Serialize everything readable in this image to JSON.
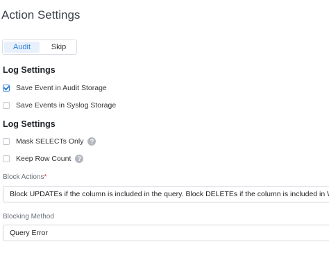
{
  "header": {
    "title": "Action Settings"
  },
  "mode_tabs": [
    {
      "label": "Audit",
      "active": true
    },
    {
      "label": "Skip",
      "active": false
    }
  ],
  "log_settings": {
    "heading": "Log Settings",
    "options": [
      {
        "label": "Save Event in Audit Storage",
        "checked": true
      },
      {
        "label": "Save Events in Syslog Storage",
        "checked": false
      }
    ]
  },
  "log_settings_2": {
    "heading": "Log Settings",
    "options": [
      {
        "label": "Mask SELECTs Only",
        "checked": false,
        "help": "?"
      },
      {
        "label": "Keep Row Count",
        "checked": false,
        "help": "?"
      }
    ]
  },
  "block_actions": {
    "label": "Block Actions",
    "required_mark": "*",
    "value": "Block UPDATEs if the column is included in the query. Block DELETEs if the column is included in WHERE clause"
  },
  "blocking_method": {
    "label": "Blocking Method",
    "value": "Query Error"
  },
  "colors": {
    "accent": "#2f7fd8",
    "required": "#d9363e"
  }
}
